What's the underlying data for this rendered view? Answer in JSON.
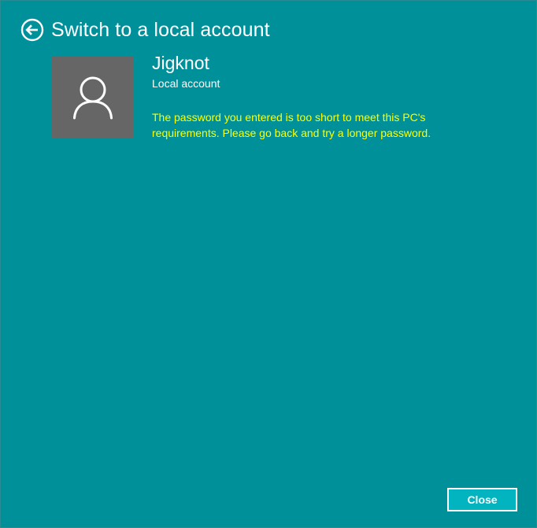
{
  "colors": {
    "background": "#00909A",
    "avatar_background": "#666666",
    "text": "#FFFFFF",
    "error_text": "#FFFF00",
    "button_background": "#01B4BF",
    "button_border": "#FFFFFF"
  },
  "header": {
    "back_icon": "back-arrow-circle-icon",
    "title": "Switch to a local account"
  },
  "account": {
    "avatar_icon": "user-silhouette-icon",
    "name": "Jigknot",
    "type": "Local account",
    "error_message": "The password you entered is too short to meet this PC's requirements. Please go back and try a longer password."
  },
  "footer": {
    "close_label": "Close"
  }
}
